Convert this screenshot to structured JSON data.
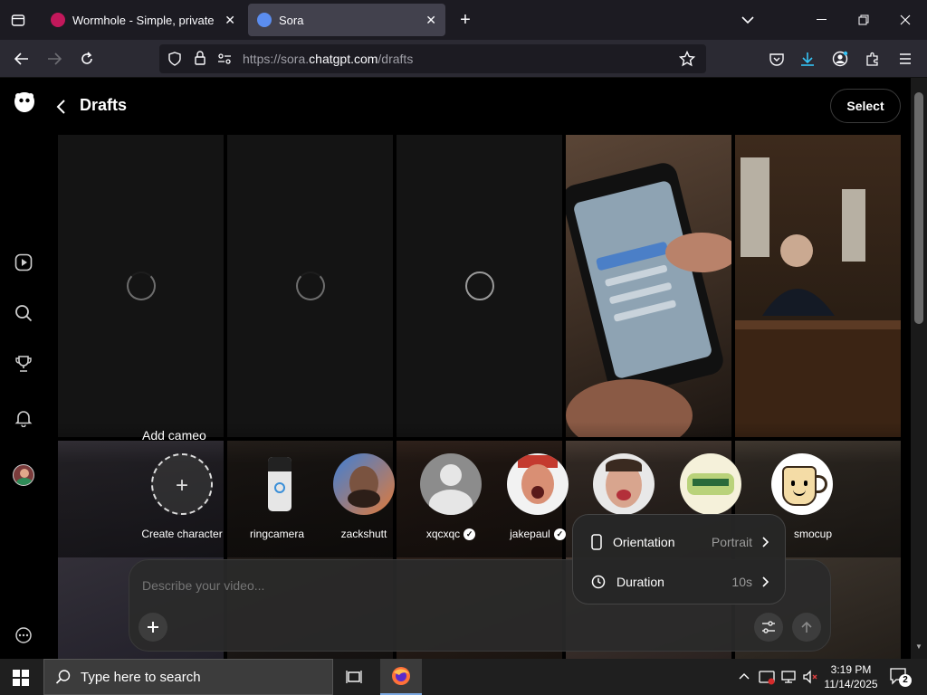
{
  "browser": {
    "tabs": [
      {
        "title": "Wormhole - Simple, private file",
        "active": false
      },
      {
        "title": "Sora",
        "active": true
      }
    ],
    "url_prefix": "https://sora.",
    "url_domain": "chatgpt.com",
    "url_path": "/drafts"
  },
  "header": {
    "title": "Drafts",
    "select_label": "Select"
  },
  "sidebar": {
    "items": [
      "sora-logo-icon",
      "video-play-icon",
      "search-icon",
      "trophy-icon",
      "bell-icon",
      "avatar",
      "more-icon"
    ]
  },
  "cameo_bar": {
    "title": "Add cameo",
    "items": [
      {
        "name": "Create character",
        "verified": false
      },
      {
        "name": "ringcamera",
        "verified": false
      },
      {
        "name": "zackshutt",
        "verified": false
      },
      {
        "name": "xqcxqc",
        "verified": true
      },
      {
        "name": "jakepaul",
        "verified": true
      },
      {
        "name": "smocup",
        "verified": false
      }
    ]
  },
  "composer": {
    "placeholder": "Describe your video..."
  },
  "settings_popover": {
    "orientation_label": "Orientation",
    "orientation_value": "Portrait",
    "duration_label": "Duration",
    "duration_value": "10s"
  },
  "taskbar": {
    "search_placeholder": "Type here to search",
    "time": "3:19 PM",
    "date": "11/14/2025",
    "notification_count": "2"
  },
  "colors": {
    "accent": "#0a84ff",
    "background": "#000000",
    "panel": "#2a2a2a"
  }
}
